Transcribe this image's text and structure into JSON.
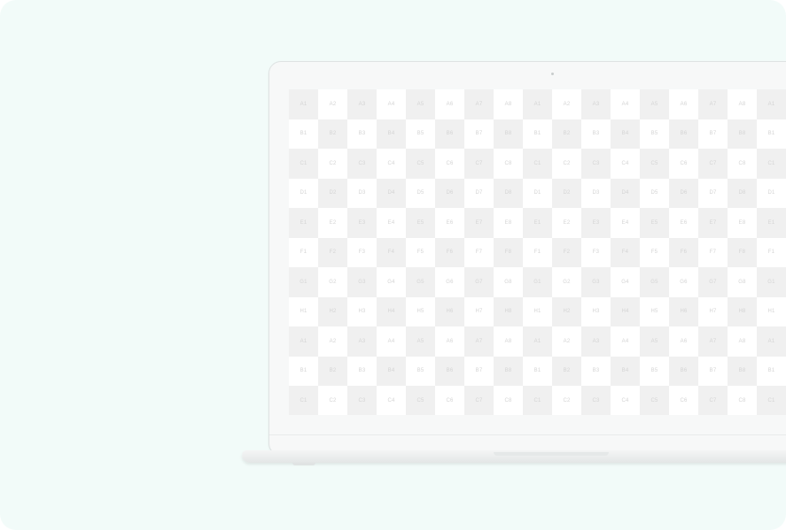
{
  "scene": {
    "background_color": "#f2fbf9",
    "device": "laptop"
  },
  "screen": {
    "row_labels": [
      "A",
      "B",
      "C",
      "D",
      "E",
      "F",
      "G",
      "H",
      "A",
      "B",
      "C"
    ],
    "column_numbers": [
      "1",
      "2",
      "3",
      "4",
      "5",
      "6",
      "7",
      "8",
      "1",
      "2",
      "3",
      "4",
      "5",
      "6",
      "7",
      "8",
      "1"
    ],
    "checker_dark": "#f0f0f0",
    "checker_light": "#ffffff",
    "label_color": "#d4d4d4"
  }
}
